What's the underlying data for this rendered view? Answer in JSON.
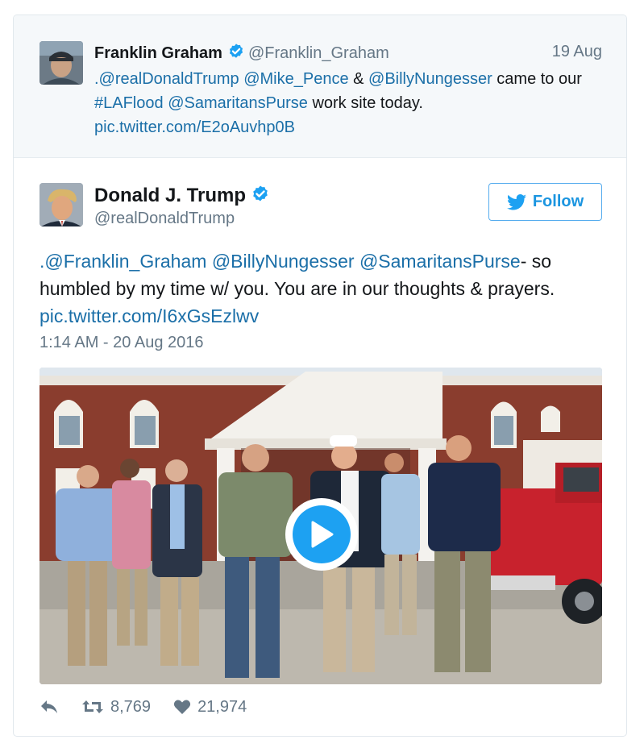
{
  "quoted_tweet": {
    "name": "Franklin Graham",
    "handle": "@Franklin_Graham",
    "date": "19 Aug",
    "text_parts": [
      {
        "text": ".@realDonaldTrump",
        "link": true
      },
      {
        "text": " ",
        "link": false
      },
      {
        "text": "@Mike_Pence",
        "link": true
      },
      {
        "text": " & ",
        "link": false
      },
      {
        "text": "@BillyNungesser",
        "link": true
      },
      {
        "text": " came to our ",
        "link": false
      },
      {
        "text": "#LAFlood",
        "link": true
      },
      {
        "text": " ",
        "link": false
      },
      {
        "text": "@SamaritansPurse",
        "link": true
      },
      {
        "text": " work site today.",
        "link": false
      }
    ],
    "pic_link": "pic.twitter.com/E2oAuvhp0B"
  },
  "tweet": {
    "name": "Donald J. Trump",
    "handle": "@realDonaldTrump",
    "follow_label": "Follow",
    "text_parts": [
      {
        "text": ".@Franklin_Graham",
        "link": true
      },
      {
        "text": " ",
        "link": false
      },
      {
        "text": "@BillyNungesser",
        "link": true
      },
      {
        "text": " ",
        "link": false
      },
      {
        "text": "@SamaritansPurse",
        "link": true
      },
      {
        "text": "- so humbled by my time w/ you. You are in our thoughts & prayers.",
        "link": false
      }
    ],
    "pic_link": "pic.twitter.com/I6xGsEzlwv",
    "timestamp": "1:14 AM - 20 Aug 2016",
    "retweets": "8,769",
    "likes": "21,974"
  },
  "colors": {
    "link": "#1b6fa8",
    "verified": "#1da1f2",
    "follow": "#1b95e0",
    "muted": "#657786",
    "quoted_bg": "#f5f8fa"
  },
  "icons": [
    "verified-badge-icon",
    "twitter-bird-icon",
    "play-icon",
    "reply-icon",
    "retweet-icon",
    "heart-icon"
  ]
}
